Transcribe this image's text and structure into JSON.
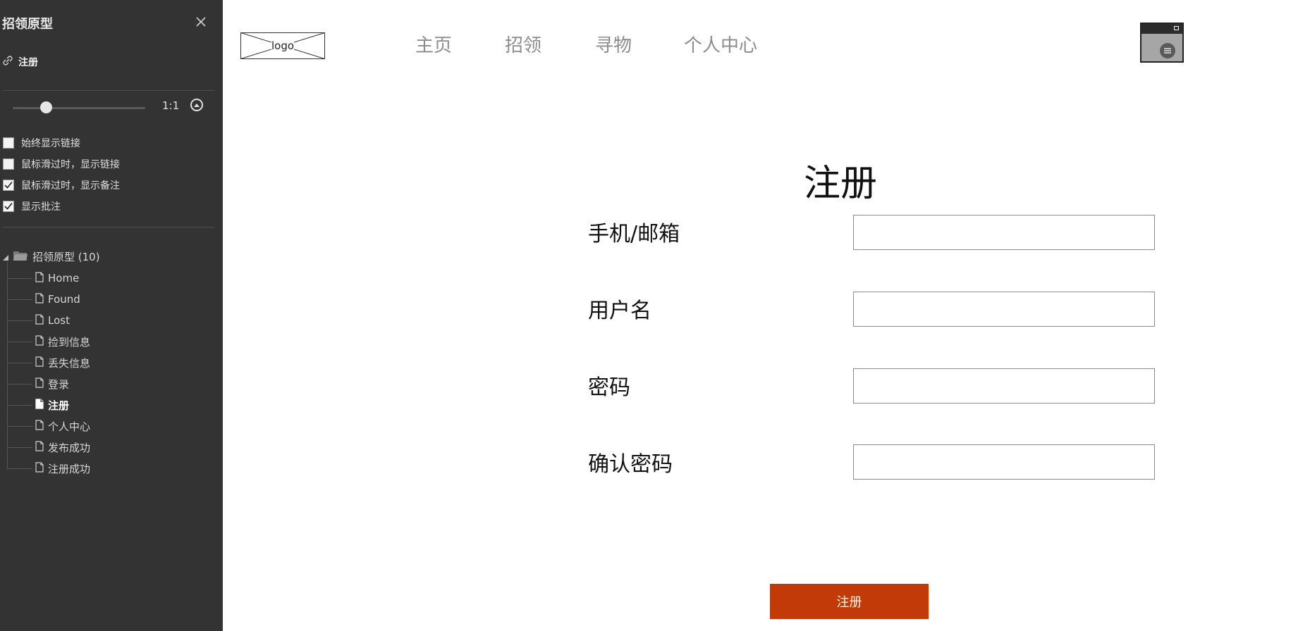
{
  "sidebar": {
    "title": "招领原型",
    "current_page": "注册",
    "zoom": {
      "label": "1:1",
      "level": 0.25
    },
    "options": [
      {
        "label": "始终显示链接",
        "checked": false
      },
      {
        "label": "鼠标滑过时，显示链接",
        "checked": false
      },
      {
        "label": "鼠标滑过时，显示备注",
        "checked": true
      },
      {
        "label": "显示批注",
        "checked": true
      }
    ],
    "tree": {
      "root_label": "招领原型 (10)",
      "items": [
        {
          "label": "Home",
          "current": false
        },
        {
          "label": "Found",
          "current": false
        },
        {
          "label": "Lost",
          "current": false
        },
        {
          "label": "捡到信息",
          "current": false
        },
        {
          "label": "丢失信息",
          "current": false
        },
        {
          "label": "登录",
          "current": false
        },
        {
          "label": "注册",
          "current": true
        },
        {
          "label": "个人中心",
          "current": false
        },
        {
          "label": "发布成功",
          "current": false
        },
        {
          "label": "注册成功",
          "current": false
        }
      ]
    }
  },
  "header": {
    "logo_text": "logo",
    "nav": [
      "主页",
      "招领",
      "寻物",
      "个人中心"
    ]
  },
  "form": {
    "title": "注册",
    "fields": [
      {
        "label": "手机/邮箱",
        "value": ""
      },
      {
        "label": "用户名",
        "value": ""
      },
      {
        "label": "密码",
        "value": ""
      },
      {
        "label": "确认密码",
        "value": ""
      }
    ],
    "submit_label": "注册"
  },
  "colors": {
    "sidebar_bg": "#333333",
    "submit_bg": "#c13a08",
    "nav_text": "#8c8c8c"
  }
}
